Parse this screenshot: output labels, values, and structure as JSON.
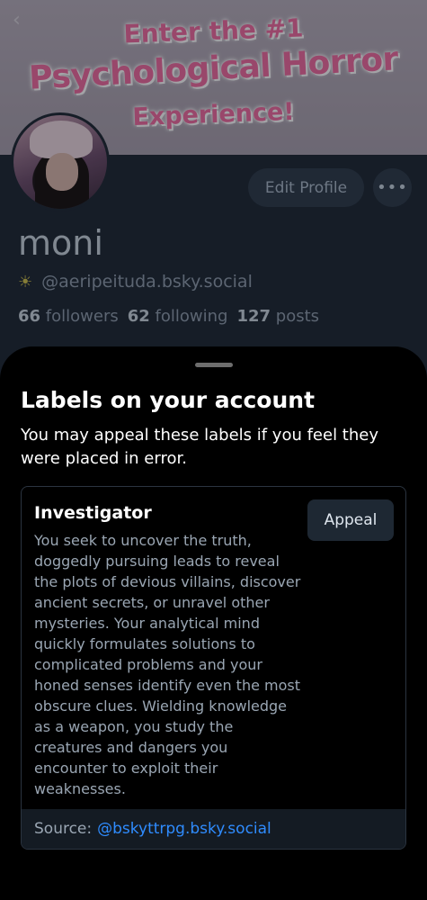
{
  "profile": {
    "banner": {
      "line1": "Enter the #1",
      "line2": "Psychological Horror",
      "line3": "Experience!"
    },
    "back_icon": "chevron-left-icon",
    "edit_label": "Edit Profile",
    "more_label": "•••",
    "name": "moni",
    "handle_icon": "☀",
    "handle": "@aeripeituda.bsky.social",
    "followers_count": "66",
    "followers_label": "followers",
    "following_count": "62",
    "following_label": "following",
    "posts_count": "127",
    "posts_label": "posts"
  },
  "sheet": {
    "title": "Labels on your account",
    "description": "You may appeal these labels if you feel they were placed in error.",
    "label_card": {
      "title": "Investigator",
      "body": "You seek to uncover the truth, doggedly pursuing leads to reveal the plots of devious villains, discover ancient secrets, or unravel other mysteries. Your analytical mind quickly formulates solutions to complicated problems and your honed senses identify even the most obscure clues. Wielding knowledge as a weapon, you study the creatures and dangers you encounter to exploit their weaknesses.",
      "appeal_label": "Appeal",
      "source_prefix": "Source:",
      "source_link": "@bskyttrpg.bsky.social"
    }
  },
  "colors": {
    "accent_link": "#2f8cff",
    "sheet_bg": "#000000",
    "profile_bg": "#1d2733"
  }
}
